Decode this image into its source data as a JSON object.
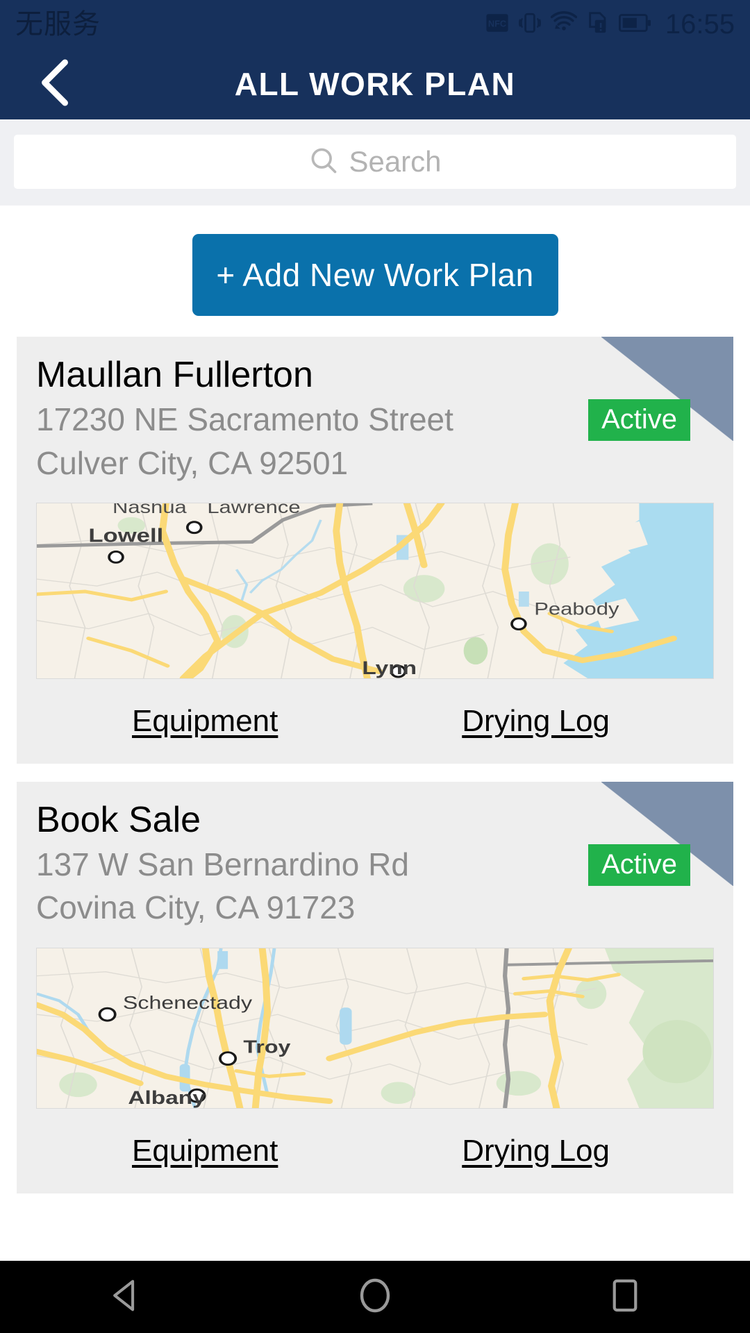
{
  "status_bar": {
    "carrier": "无服务",
    "time": "16:55",
    "icons": [
      "nfc-icon",
      "vibrate-icon",
      "wifi-icon",
      "sim-alert-icon",
      "battery-icon"
    ]
  },
  "app_bar": {
    "title": "ALL WORK PLAN",
    "back_icon": "chevron-left-icon"
  },
  "search": {
    "placeholder": "Search",
    "value": "",
    "icon": "search-icon"
  },
  "actions": {
    "add_label": "+ Add New Work Plan"
  },
  "colors": {
    "header": "#17315c",
    "accent": "#0a71ab",
    "badge_active": "#21b24b",
    "ribbon": "#7d90ab",
    "card_bg": "#eeeeee",
    "search_bg": "#eff0f3"
  },
  "work_plans": [
    {
      "title": "Maullan Fullerton",
      "address_line1": "17230 NE Sacramento Street",
      "address_line2": "Culver City, CA 92501",
      "status": "Active",
      "links": {
        "equipment": "Equipment",
        "drying_log": "Drying Log"
      },
      "map_labels": [
        "Nashua",
        "Lawrence",
        "Lowell",
        "Peabody",
        "Lynn"
      ]
    },
    {
      "title": "Book Sale",
      "address_line1": "137 W San Bernardino Rd",
      "address_line2": "Covina City, CA 91723",
      "status": "Active",
      "links": {
        "equipment": "Equipment",
        "drying_log": "Drying Log"
      },
      "map_labels": [
        "Schenectady",
        "Troy",
        "Albany"
      ]
    }
  ],
  "nav_bar": {
    "back": "back-triangle-icon",
    "home": "home-circle-icon",
    "recents": "recents-square-icon"
  }
}
